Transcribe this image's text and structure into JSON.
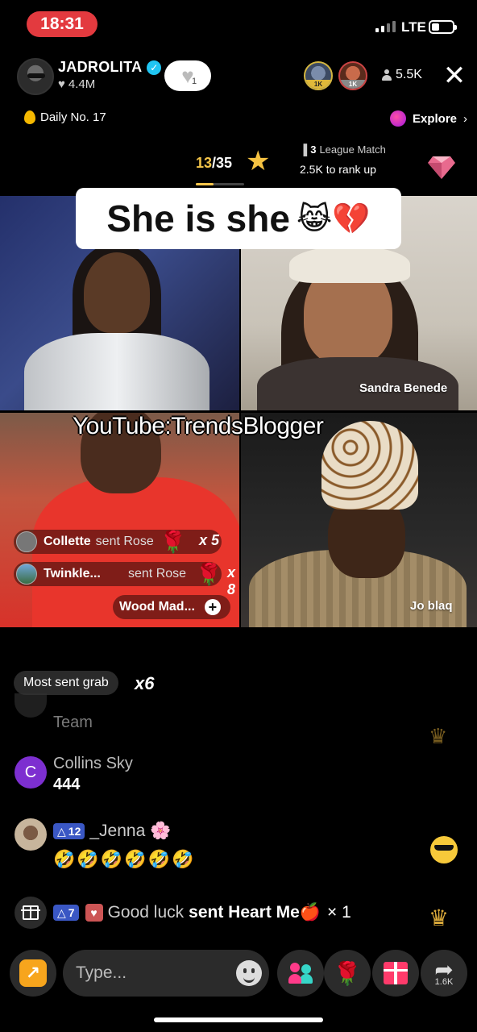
{
  "status_bar": {
    "time": "18:31",
    "network": "LTE"
  },
  "host": {
    "name": "JADROLITA",
    "likes": "4.4M",
    "like_button_count": "1"
  },
  "top_viewers": [
    "1K",
    "1K"
  ],
  "viewer_count": "5.5K",
  "daily": {
    "label": "Daily No. 17"
  },
  "explore": {
    "label": "Explore"
  },
  "league": {
    "rank_current": "13",
    "rank_total": "/35",
    "league_count": "3",
    "league_label": "League Match",
    "rank_up_text": "2.5K to rank up"
  },
  "caption": {
    "text": "She is she",
    "emoji": "😹💔"
  },
  "watermark": "YouTube:TrendsBlogger",
  "guests": [
    {
      "name": ""
    },
    {
      "name": "Sandra Benede"
    },
    {
      "name": ""
    },
    {
      "name": "Jo blaq"
    }
  ],
  "gift_notifications": [
    {
      "sender": "Collette",
      "verb": "sent Rose",
      "gift": "🌹",
      "count": "x 5"
    },
    {
      "sender": "Twinkle...",
      "verb": "sent Rose",
      "gift": "🌹",
      "count": "x 8"
    }
  ],
  "wood_pill": {
    "label": "Wood Mad..."
  },
  "most_sent": {
    "label": "Most sent grab",
    "count": "x6"
  },
  "chat": {
    "faded": {
      "text": "Team"
    },
    "collins": {
      "avatar_letter": "C",
      "name": "Collins Sky",
      "message": "444"
    },
    "jenna": {
      "level": "12",
      "name": "_Jenna",
      "flower": "🌸",
      "message": "🤣🤣🤣🤣🤣🤣"
    },
    "gift_line": {
      "level": "7",
      "name": "Good luck",
      "text": "sent Heart Me",
      "gift": "🍎",
      "count": "× 1"
    }
  },
  "input": {
    "placeholder": "Type..."
  },
  "bottom": {
    "share_count": "1.6K"
  },
  "colors": {
    "time_pill": "#e33a3f",
    "rank_gold": "#f6c64a",
    "badge_blue": "#3a57c4"
  }
}
